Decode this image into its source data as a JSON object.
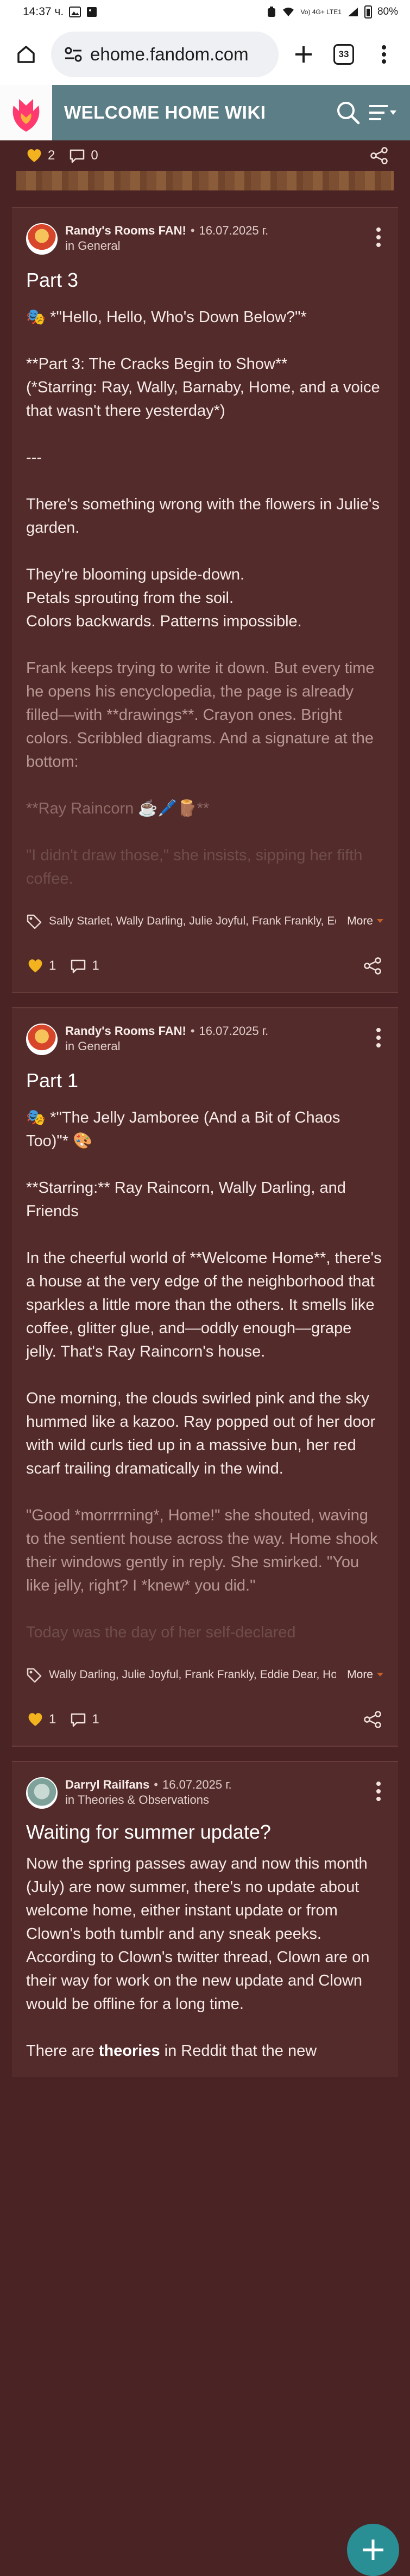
{
  "status_bar": {
    "time": "14:37",
    "unit_suffix": "ч.",
    "signal_text": "Vo) 4G+ LTE1",
    "battery": "80%"
  },
  "browser": {
    "url": "ehome.fandom.com",
    "tab_count": "33"
  },
  "wiki": {
    "title": "WELCOME HOME WIKI"
  },
  "top_reactions": {
    "likes": "2",
    "comments": "0"
  },
  "posts": [
    {
      "author": "Randy's Rooms FAN!",
      "date": "16.07.2025 г.",
      "category_prefix": "in",
      "category": "General",
      "title": "Part 3",
      "lines": [
        "🎭 *\"Hello, Hello, Who's Down Below?\"*",
        "**Part 3: The Cracks Begin to Show**",
        "(*Starring: Ray, Wally, Barnaby, Home, and a voice that wasn't there yesterday*)",
        "---",
        "There's something wrong with the flowers in Julie's garden.",
        "They're blooming upside-down.",
        "Petals sprouting from the soil.",
        "Colors backwards. Patterns impossible.",
        "Frank keeps trying to write it down. But every time he opens his encyclopedia, the page is already filled—with **drawings**. Crayon ones. Bright colors. Scribbled diagrams. And a signature at the bottom:",
        "**Ray Raincorn ☕️🖊️🪵**",
        "\"I didn't draw those,\" she insists, sipping her fifth coffee."
      ],
      "tags": "Sally Starlet, Wally Darling, Julie Joyful, Frank Frankly, Eddie",
      "more_label": "More",
      "likes": "1",
      "comments": "1"
    },
    {
      "author": "Randy's Rooms FAN!",
      "date": "16.07.2025 г.",
      "category_prefix": "in",
      "category": "General",
      "title": "Part 1",
      "lines": [
        "🎭 *\"The Jelly Jamboree (And a Bit of Chaos Too)\"* 🎨",
        "**Starring:** Ray Raincorn, Wally Darling, and Friends",
        "In the cheerful world of **Welcome Home**, there's a house at the very edge of the neighborhood that sparkles a little more than the others. It smells like coffee, glitter glue, and—oddly enough—grape jelly. That's Ray Raincorn's house.",
        "One morning, the clouds swirled pink and the sky hummed like a kazoo. Ray popped out of her door with wild curls tied up in a massive bun, her red scarf trailing dramatically in the wind.",
        "\"Good *morrrrning*, Home!\" she shouted, waving to the sentient house across the way. Home shook their windows gently in reply. She smirked. \"You like jelly, right? I *knew* you did.\"",
        "Today was the day of her self-declared"
      ],
      "tags": "Wally Darling, Julie Joyful, Frank Frankly, Eddie Dear, Howdy Pillar",
      "more_label": "More",
      "likes": "1",
      "comments": "1"
    },
    {
      "author": "Darryl Railfans",
      "date": "16.07.2025 г.",
      "category_prefix": "in",
      "category": "Theories & Observations",
      "title": "Waiting for summer update?",
      "lines": [
        "Now the spring passes away and now this month (July) are now summer, there's no update about welcome home, either instant update or from Clown's both tumblr and any sneak peeks. According to Clown's twitter thread, Clown are on their way for work on the new update and Clown would be offline for a long time.",
        "There are ",
        "theories",
        " in Reddit that the new"
      ]
    }
  ],
  "colors": {
    "page_bg": "#4a2424",
    "card_bg": "#532b2b",
    "header_teal": "#5c7e86",
    "fab_teal": "#2a8e95",
    "heart": "#f2b31e",
    "fandom_logo": "#ff3a6e"
  }
}
